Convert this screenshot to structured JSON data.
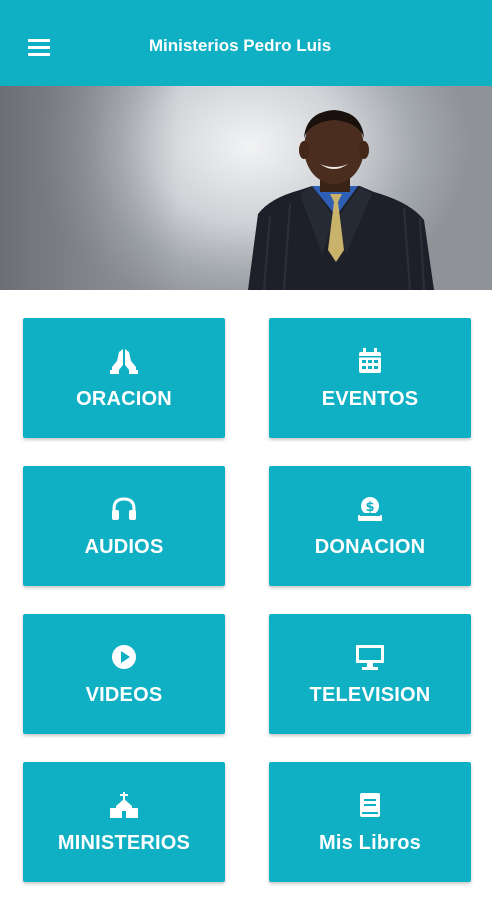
{
  "appbar": {
    "title": "Ministerios Pedro Luis",
    "menu_icon": "hamburger-menu-icon",
    "background": "#0fb0c4"
  },
  "hero": {
    "image": "pastor-portrait"
  },
  "tiles": [
    {
      "label": "ORACION",
      "icon": "praying-hands-icon"
    },
    {
      "label": "EVENTOS",
      "icon": "calendar-icon"
    },
    {
      "label": "AUDIOS",
      "icon": "headphones-icon"
    },
    {
      "label": "DONACION",
      "icon": "donation-icon"
    },
    {
      "label": "VIDEOS",
      "icon": "play-circle-icon"
    },
    {
      "label": "TELEVISION",
      "icon": "television-icon"
    },
    {
      "label": "MINISTERIOS",
      "icon": "church-icon"
    },
    {
      "label": "Mis Libros",
      "icon": "book-icon"
    }
  ],
  "colors": {
    "accent": "#0fb0c4",
    "tile_text": "#ffffff"
  }
}
